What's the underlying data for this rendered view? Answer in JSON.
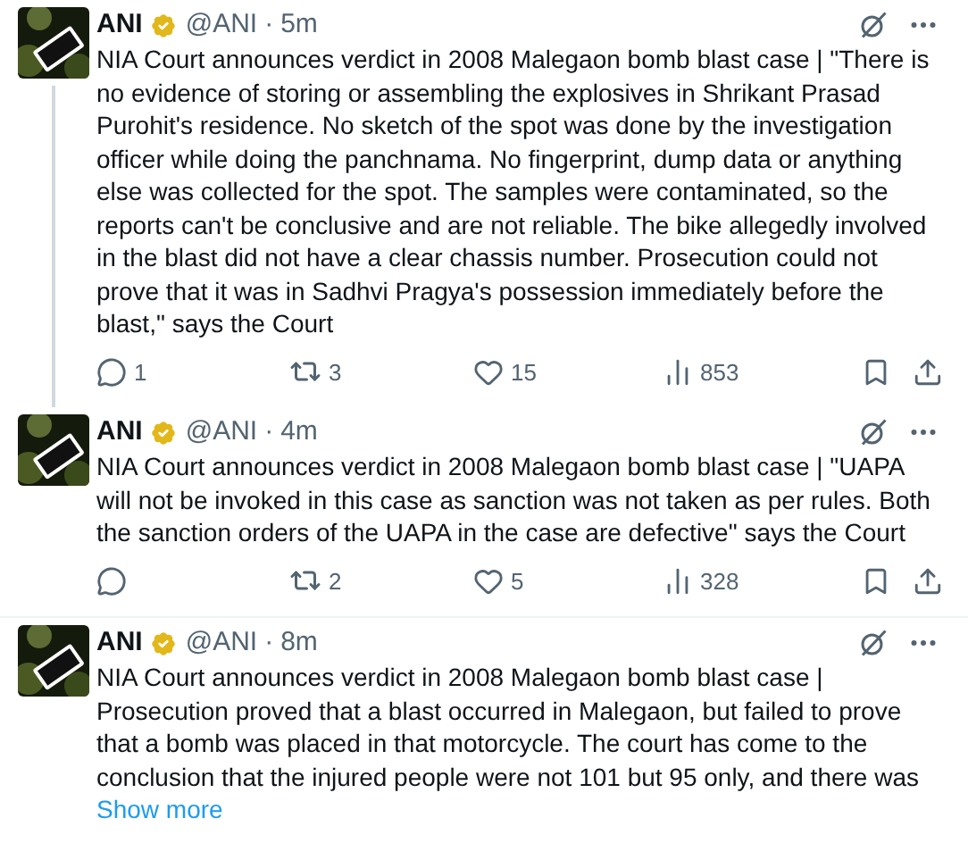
{
  "tweets": [
    {
      "author": "ANI",
      "verified": true,
      "handle": "@ANI",
      "separator": "·",
      "time": "5m",
      "text": "NIA Court announces verdict in 2008 Malegaon bomb blast case | \"There is no evidence of storing or assembling the explosives in Shrikant Prasad Purohit's residence. No sketch of the spot was done by the investigation officer while doing the panchnama. No fingerprint, dump data or anything else was collected for the spot. The samples were contaminated, so the reports can't be conclusive and are not reliable. The bike allegedly involved in the blast did not have a clear chassis number. Prosecution could not prove that it was in Sadhvi Pragya's possession immediately before the blast,\" says the Court",
      "thread_line": true,
      "replies": "1",
      "reposts": "3",
      "likes": "15",
      "views": "853"
    },
    {
      "author": "ANI",
      "verified": true,
      "handle": "@ANI",
      "separator": "·",
      "time": "4m",
      "text": "NIA Court announces verdict in 2008 Malegaon bomb blast case | \"UAPA will not be invoked in this case as sanction was not taken as per rules. Both the sanction orders of the UAPA in the case are defective\" says the Court",
      "thread_line": false,
      "reposts": "2",
      "likes": "5",
      "views": "328"
    },
    {
      "author": "ANI",
      "verified": true,
      "handle": "@ANI",
      "separator": "·",
      "time": "8m",
      "text": "NIA Court announces verdict in 2008 Malegaon bomb blast case | Prosecution proved that a blast occurred in Malegaon, but failed to prove that a bomb was placed in that motorcycle. The court has come to the conclusion that the injured people were not 101 but 95 only, and there was",
      "thread_line": false,
      "show_more": "Show more"
    }
  ]
}
